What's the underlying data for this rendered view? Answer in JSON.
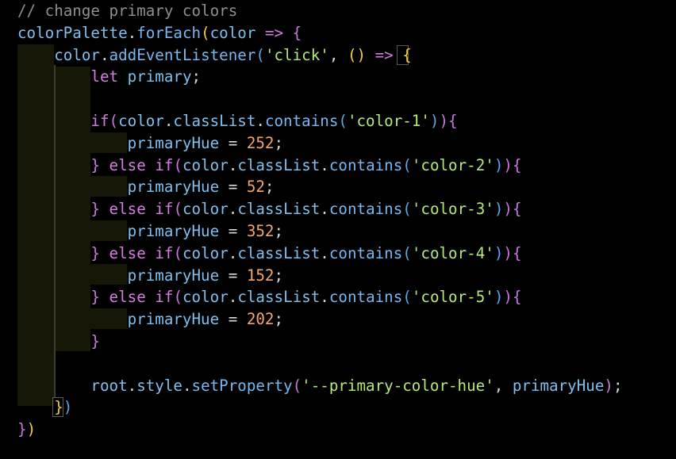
{
  "editor": {
    "theme": {
      "background": "#000000",
      "comment": "#8b8f96",
      "variable": "#7ec0ef",
      "function": "#76b8f2",
      "keyword": "#d67ce3",
      "string": "#b4e97b",
      "number": "#f5a66a",
      "bracket_yellow": "#f1d130",
      "bracket_purple": "#c678dd",
      "bracket_blue": "#5aa8e8"
    },
    "lines": [
      {
        "tokens": [
          {
            "t": "// change primary colors",
            "c": "comment"
          }
        ]
      },
      {
        "tokens": [
          {
            "t": "colorPalette",
            "c": "var"
          },
          {
            "t": ".",
            "c": "punct"
          },
          {
            "t": "forEach",
            "c": "fn"
          },
          {
            "t": "(",
            "c": "yellow"
          },
          {
            "t": "color",
            "c": "var"
          },
          {
            "t": " ",
            "c": "punct"
          },
          {
            "t": "=>",
            "c": "keyword"
          },
          {
            "t": " ",
            "c": "punct"
          },
          {
            "t": "{",
            "c": "purple"
          }
        ]
      },
      {
        "tokens": [
          {
            "t": "    ",
            "c": "punct"
          },
          {
            "t": "color",
            "c": "var"
          },
          {
            "t": ".",
            "c": "punct"
          },
          {
            "t": "addEventListener",
            "c": "fn"
          },
          {
            "t": "(",
            "c": "blue"
          },
          {
            "t": "'click'",
            "c": "string"
          },
          {
            "t": ", ",
            "c": "punct"
          },
          {
            "t": "()",
            "c": "yellow"
          },
          {
            "t": " ",
            "c": "punct"
          },
          {
            "t": "=>",
            "c": "keyword"
          },
          {
            "t": " ",
            "c": "punct"
          },
          {
            "t": "{",
            "c": "yellow"
          }
        ]
      },
      {
        "tokens": [
          {
            "t": "        ",
            "c": "punct"
          },
          {
            "t": "let",
            "c": "keyword"
          },
          {
            "t": " ",
            "c": "punct"
          },
          {
            "t": "primary",
            "c": "var"
          },
          {
            "t": ";",
            "c": "punct"
          }
        ]
      },
      {
        "tokens": [
          {
            "t": "",
            "c": "punct"
          }
        ]
      },
      {
        "tokens": [
          {
            "t": "        ",
            "c": "punct"
          },
          {
            "t": "if",
            "c": "keyword"
          },
          {
            "t": "(",
            "c": "purple"
          },
          {
            "t": "color",
            "c": "var"
          },
          {
            "t": ".",
            "c": "punct"
          },
          {
            "t": "classList",
            "c": "var"
          },
          {
            "t": ".",
            "c": "punct"
          },
          {
            "t": "contains",
            "c": "fn"
          },
          {
            "t": "(",
            "c": "blue"
          },
          {
            "t": "'color-1'",
            "c": "string"
          },
          {
            "t": ")",
            "c": "blue"
          },
          {
            "t": ")",
            "c": "purple"
          },
          {
            "t": "{",
            "c": "purple"
          }
        ]
      },
      {
        "tokens": [
          {
            "t": "            ",
            "c": "punct"
          },
          {
            "t": "primaryHue",
            "c": "var"
          },
          {
            "t": " = ",
            "c": "punct"
          },
          {
            "t": "252",
            "c": "number"
          },
          {
            "t": ";",
            "c": "punct"
          }
        ]
      },
      {
        "tokens": [
          {
            "t": "        ",
            "c": "punct"
          },
          {
            "t": "}",
            "c": "purple"
          },
          {
            "t": " ",
            "c": "punct"
          },
          {
            "t": "else",
            "c": "keyword"
          },
          {
            "t": " ",
            "c": "punct"
          },
          {
            "t": "if",
            "c": "keyword"
          },
          {
            "t": "(",
            "c": "purple"
          },
          {
            "t": "color",
            "c": "var"
          },
          {
            "t": ".",
            "c": "punct"
          },
          {
            "t": "classList",
            "c": "var"
          },
          {
            "t": ".",
            "c": "punct"
          },
          {
            "t": "contains",
            "c": "fn"
          },
          {
            "t": "(",
            "c": "blue"
          },
          {
            "t": "'color-2'",
            "c": "string"
          },
          {
            "t": ")",
            "c": "blue"
          },
          {
            "t": ")",
            "c": "purple"
          },
          {
            "t": "{",
            "c": "purple"
          }
        ]
      },
      {
        "tokens": [
          {
            "t": "            ",
            "c": "punct"
          },
          {
            "t": "primaryHue",
            "c": "var"
          },
          {
            "t": " = ",
            "c": "punct"
          },
          {
            "t": "52",
            "c": "number"
          },
          {
            "t": ";",
            "c": "punct"
          }
        ]
      },
      {
        "tokens": [
          {
            "t": "        ",
            "c": "punct"
          },
          {
            "t": "}",
            "c": "purple"
          },
          {
            "t": " ",
            "c": "punct"
          },
          {
            "t": "else",
            "c": "keyword"
          },
          {
            "t": " ",
            "c": "punct"
          },
          {
            "t": "if",
            "c": "keyword"
          },
          {
            "t": "(",
            "c": "purple"
          },
          {
            "t": "color",
            "c": "var"
          },
          {
            "t": ".",
            "c": "punct"
          },
          {
            "t": "classList",
            "c": "var"
          },
          {
            "t": ".",
            "c": "punct"
          },
          {
            "t": "contains",
            "c": "fn"
          },
          {
            "t": "(",
            "c": "blue"
          },
          {
            "t": "'color-3'",
            "c": "string"
          },
          {
            "t": ")",
            "c": "blue"
          },
          {
            "t": ")",
            "c": "purple"
          },
          {
            "t": "{",
            "c": "purple"
          }
        ]
      },
      {
        "tokens": [
          {
            "t": "            ",
            "c": "punct"
          },
          {
            "t": "primaryHue",
            "c": "var"
          },
          {
            "t": " = ",
            "c": "punct"
          },
          {
            "t": "352",
            "c": "number"
          },
          {
            "t": ";",
            "c": "punct"
          }
        ]
      },
      {
        "tokens": [
          {
            "t": "        ",
            "c": "punct"
          },
          {
            "t": "}",
            "c": "purple"
          },
          {
            "t": " ",
            "c": "punct"
          },
          {
            "t": "else",
            "c": "keyword"
          },
          {
            "t": " ",
            "c": "punct"
          },
          {
            "t": "if",
            "c": "keyword"
          },
          {
            "t": "(",
            "c": "purple"
          },
          {
            "t": "color",
            "c": "var"
          },
          {
            "t": ".",
            "c": "punct"
          },
          {
            "t": "classList",
            "c": "var"
          },
          {
            "t": ".",
            "c": "punct"
          },
          {
            "t": "contains",
            "c": "fn"
          },
          {
            "t": "(",
            "c": "blue"
          },
          {
            "t": "'color-4'",
            "c": "string"
          },
          {
            "t": ")",
            "c": "blue"
          },
          {
            "t": ")",
            "c": "purple"
          },
          {
            "t": "{",
            "c": "purple"
          }
        ]
      },
      {
        "tokens": [
          {
            "t": "            ",
            "c": "punct"
          },
          {
            "t": "primaryHue",
            "c": "var"
          },
          {
            "t": " = ",
            "c": "punct"
          },
          {
            "t": "152",
            "c": "number"
          },
          {
            "t": ";",
            "c": "punct"
          }
        ]
      },
      {
        "tokens": [
          {
            "t": "        ",
            "c": "punct"
          },
          {
            "t": "}",
            "c": "purple"
          },
          {
            "t": " ",
            "c": "punct"
          },
          {
            "t": "else",
            "c": "keyword"
          },
          {
            "t": " ",
            "c": "punct"
          },
          {
            "t": "if",
            "c": "keyword"
          },
          {
            "t": "(",
            "c": "purple"
          },
          {
            "t": "color",
            "c": "var"
          },
          {
            "t": ".",
            "c": "punct"
          },
          {
            "t": "classList",
            "c": "var"
          },
          {
            "t": ".",
            "c": "punct"
          },
          {
            "t": "contains",
            "c": "fn"
          },
          {
            "t": "(",
            "c": "blue"
          },
          {
            "t": "'color-5'",
            "c": "string"
          },
          {
            "t": ")",
            "c": "blue"
          },
          {
            "t": ")",
            "c": "purple"
          },
          {
            "t": "{",
            "c": "purple"
          }
        ]
      },
      {
        "tokens": [
          {
            "t": "            ",
            "c": "punct"
          },
          {
            "t": "primaryHue",
            "c": "var"
          },
          {
            "t": " = ",
            "c": "punct"
          },
          {
            "t": "202",
            "c": "number"
          },
          {
            "t": ";",
            "c": "punct"
          }
        ]
      },
      {
        "tokens": [
          {
            "t": "        ",
            "c": "punct"
          },
          {
            "t": "}",
            "c": "purple"
          }
        ]
      },
      {
        "tokens": [
          {
            "t": "",
            "c": "punct"
          }
        ]
      },
      {
        "tokens": [
          {
            "t": "        ",
            "c": "punct"
          },
          {
            "t": "root",
            "c": "var"
          },
          {
            "t": ".",
            "c": "punct"
          },
          {
            "t": "style",
            "c": "var"
          },
          {
            "t": ".",
            "c": "punct"
          },
          {
            "t": "setProperty",
            "c": "fn"
          },
          {
            "t": "(",
            "c": "purple"
          },
          {
            "t": "'--primary-color-hue'",
            "c": "string"
          },
          {
            "t": ", ",
            "c": "punct"
          },
          {
            "t": "primaryHue",
            "c": "var"
          },
          {
            "t": ")",
            "c": "purple"
          },
          {
            "t": ";",
            "c": "punct"
          }
        ]
      },
      {
        "tokens": [
          {
            "t": "    ",
            "c": "punct"
          },
          {
            "t": "}",
            "c": "yellow"
          },
          {
            "t": ")",
            "c": "blue"
          }
        ]
      },
      {
        "tokens": [
          {
            "t": "}",
            "c": "purple"
          },
          {
            "t": ")",
            "c": "yellow"
          }
        ]
      }
    ]
  }
}
